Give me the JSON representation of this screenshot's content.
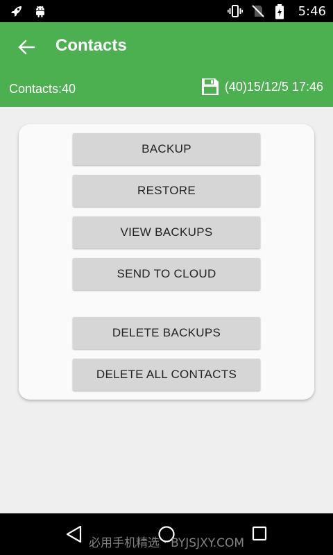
{
  "status_bar": {
    "time": "5:46",
    "left_icons": [
      "rocket-icon",
      "android-icon"
    ],
    "right_icons": [
      "vibrate-icon",
      "no-sim-icon",
      "battery-charging-icon"
    ]
  },
  "app_bar": {
    "title": "Contacts",
    "contacts_label": "Contacts:40",
    "last_backup": "(40)15/12/5 17:46",
    "color": "#4caf50"
  },
  "actions": {
    "backup": "BACKUP",
    "restore": "RESTORE",
    "view_backups": "VIEW BACKUPS",
    "send_to_cloud": "SEND TO CLOUD",
    "delete_backups": "DELETE BACKUPS",
    "delete_all_contacts": "DELETE ALL CONTACTS"
  },
  "nav_bar": {
    "icons": [
      "back-triangle-icon",
      "home-circle-icon",
      "recents-square-icon"
    ]
  },
  "watermark": "必用手机精选 · BYJSJXY.COM"
}
